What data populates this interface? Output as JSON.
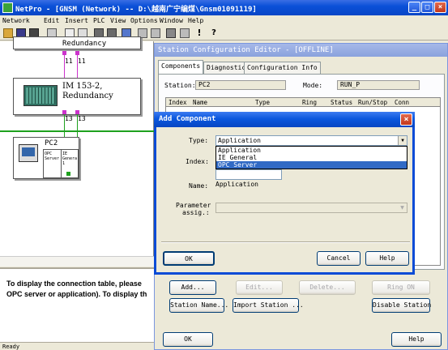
{
  "window": {
    "title": "NetPro - [GNSM (Network) -- D:\\越南广宁编煤\\Gnsm01091119]",
    "controls": [
      "_",
      "□",
      "×"
    ]
  },
  "menu": [
    "Network",
    "Edit",
    "Insert",
    "PLC",
    "View",
    "Options",
    "Window",
    "Help"
  ],
  "toolbar": {
    "icons": [
      "open-icon",
      "save-icon",
      "compile-icon",
      "print-icon",
      "copy-icon",
      "paste-icon",
      "download-icon",
      "upload-icon",
      "network-icon",
      "accessible-icon",
      "properties-icon",
      "filter-icon",
      "table-icon",
      "exclamation-icon",
      "help-pointer-icon"
    ]
  },
  "network": {
    "top_station_label": "Redundancy",
    "subnet_top_labels": [
      "11",
      "11"
    ],
    "im_station": {
      "line1": "IM 153-2,",
      "line2": "Redundancy"
    },
    "subnet_mid_labels": [
      "13",
      "13"
    ],
    "pc_station": {
      "name": "PC2",
      "opc_label": "OPC Server",
      "ie_label": "IE Genera 1"
    }
  },
  "info_panel": {
    "text": "To display the connection table, please\nOPC server or application). To display th"
  },
  "statusbar": {
    "text": "Ready"
  },
  "station_config_editor": {
    "title": "Station Configuration Editor - [OFFLINE]",
    "tabs": [
      "Components",
      "Diagnostics",
      "Configuration Info"
    ],
    "station_label": "Station:",
    "station_value": "PC2",
    "mode_label": "Mode:",
    "mode_value": "RUN_P",
    "columns": [
      "Index",
      "Name",
      "Type",
      "Ring",
      "Status",
      "Run/Stop",
      "Conn"
    ],
    "buttons": {
      "add": "Add...",
      "edit": "Edit...",
      "delete": "Delete...",
      "ring_on": "Ring ON",
      "station_name": "Station Name...",
      "import_station": "Import Station ...",
      "disable_station": "Disable Station",
      "ok": "OK",
      "help": "Help"
    }
  },
  "add_component": {
    "title": "Add Component",
    "type_label": "Type:",
    "type_value": "Application",
    "type_options": [
      "Application",
      "IE General",
      "OPC Server"
    ],
    "type_selected": "OPC Server",
    "index_label": "Index:",
    "name_label": "Name:",
    "name_value": "Application",
    "parameter_label_1": "Parameter",
    "parameter_label_2": "assig.:",
    "buttons": {
      "ok": "OK",
      "cancel": "Cancel",
      "help": "Help"
    }
  }
}
